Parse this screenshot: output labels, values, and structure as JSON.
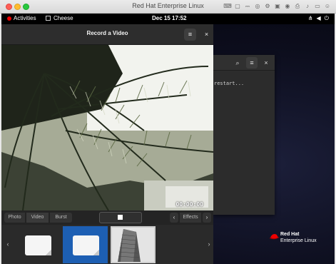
{
  "host": {
    "title": "Red Hat Enterprise Linux"
  },
  "topbar": {
    "activities": "Activities",
    "app": "Cheese",
    "clock": "Dec 15  17:52"
  },
  "cheese": {
    "title": "Record a Video",
    "timer": "00:00:00",
    "modes": {
      "photo": "Photo",
      "video": "Video",
      "burst": "Burst"
    },
    "effects": "Effects"
  },
  "terminal": {
    "text": "restart..."
  },
  "logo": {
    "line1": "Red Hat",
    "line2": "Enterprise Linux"
  }
}
